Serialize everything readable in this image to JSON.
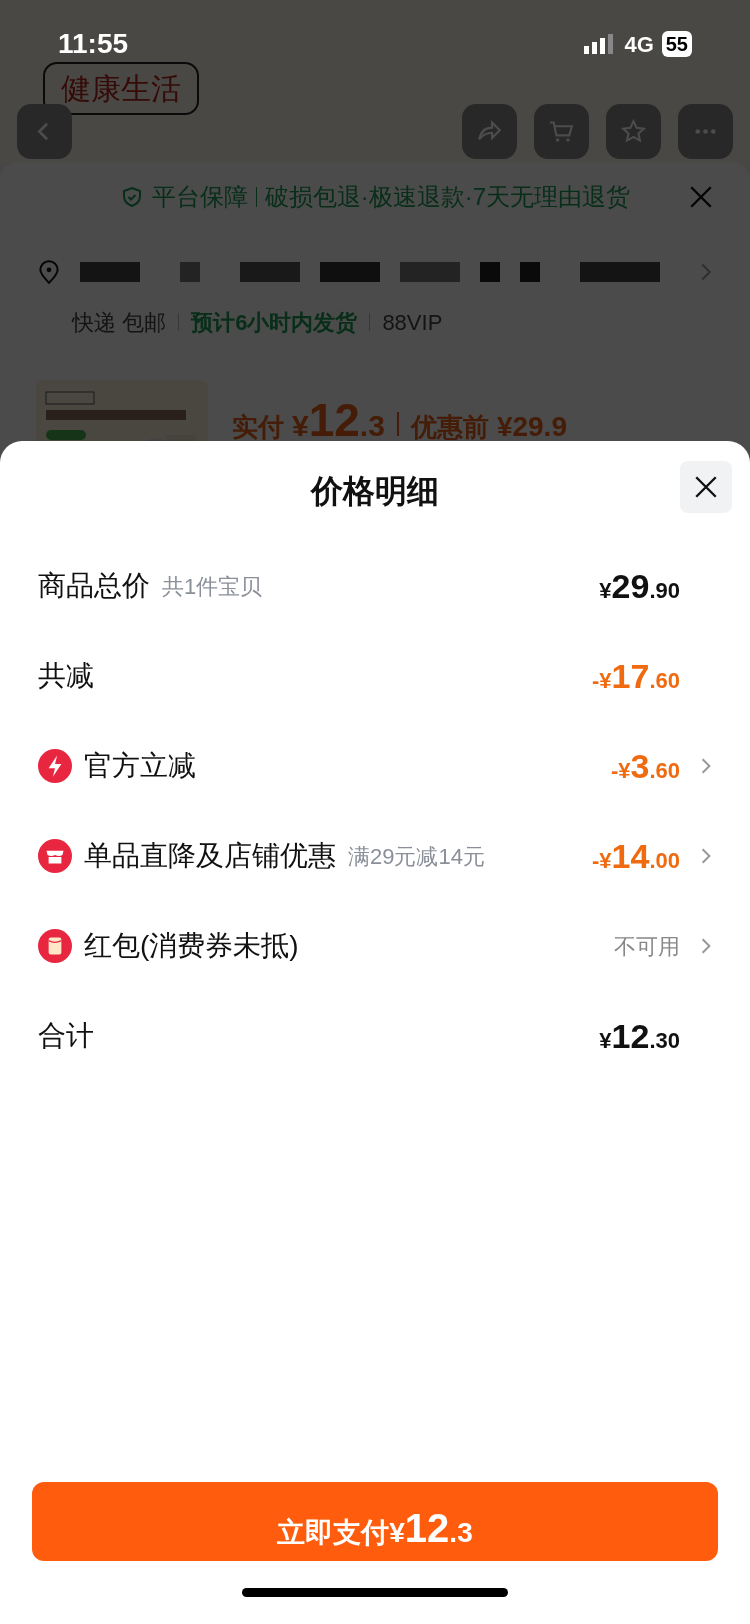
{
  "status_bar": {
    "time": "11:55",
    "network": "4G",
    "battery": "55"
  },
  "background_page": {
    "tag": "健康生活",
    "guarantee": {
      "label": "平台保障",
      "text": "破损包退·极速退款·7天无理由退货"
    },
    "shipping": [
      {
        "kind": "plain",
        "text": "快递 包邮"
      },
      {
        "kind": "highlight",
        "text": "预计6小时内发货"
      },
      {
        "kind": "plain",
        "text": "88VIP"
      }
    ],
    "product": {
      "kind": "picture",
      "paid_label": "实付",
      "paid_price": "¥12.3",
      "original_label": "优惠前",
      "original_price": "¥29.9"
    }
  },
  "sheet": {
    "title": "价格明细",
    "rows": [
      {
        "kind": "plain",
        "label": "商品总价",
        "note": "共1件宝贝",
        "amount": "¥29.90",
        "color": "#111111",
        "chevron": false
      },
      {
        "kind": "plain",
        "label": "共减",
        "amount": "-¥17.60",
        "color": "#f06a10",
        "chevron": false
      },
      {
        "kind": "bolt",
        "label": "官方立减",
        "amount": "-¥3.60",
        "color": "#f06a10",
        "chevron": true
      },
      {
        "kind": "shop",
        "label": "单品直降及店铺优惠",
        "note": "满29元减14元",
        "amount": "-¥14.00",
        "color": "#f06a10",
        "chevron": true
      },
      {
        "kind": "envelope",
        "label": "红包(消费券未抵)",
        "amount": "不可用",
        "color": "#888888",
        "chevron": true
      },
      {
        "kind": "plain",
        "label": "合计",
        "amount": "¥12.30",
        "color": "#111111",
        "chevron": false
      }
    ],
    "pay_button": {
      "label": "立即支付",
      "amount": "¥12.3"
    }
  }
}
